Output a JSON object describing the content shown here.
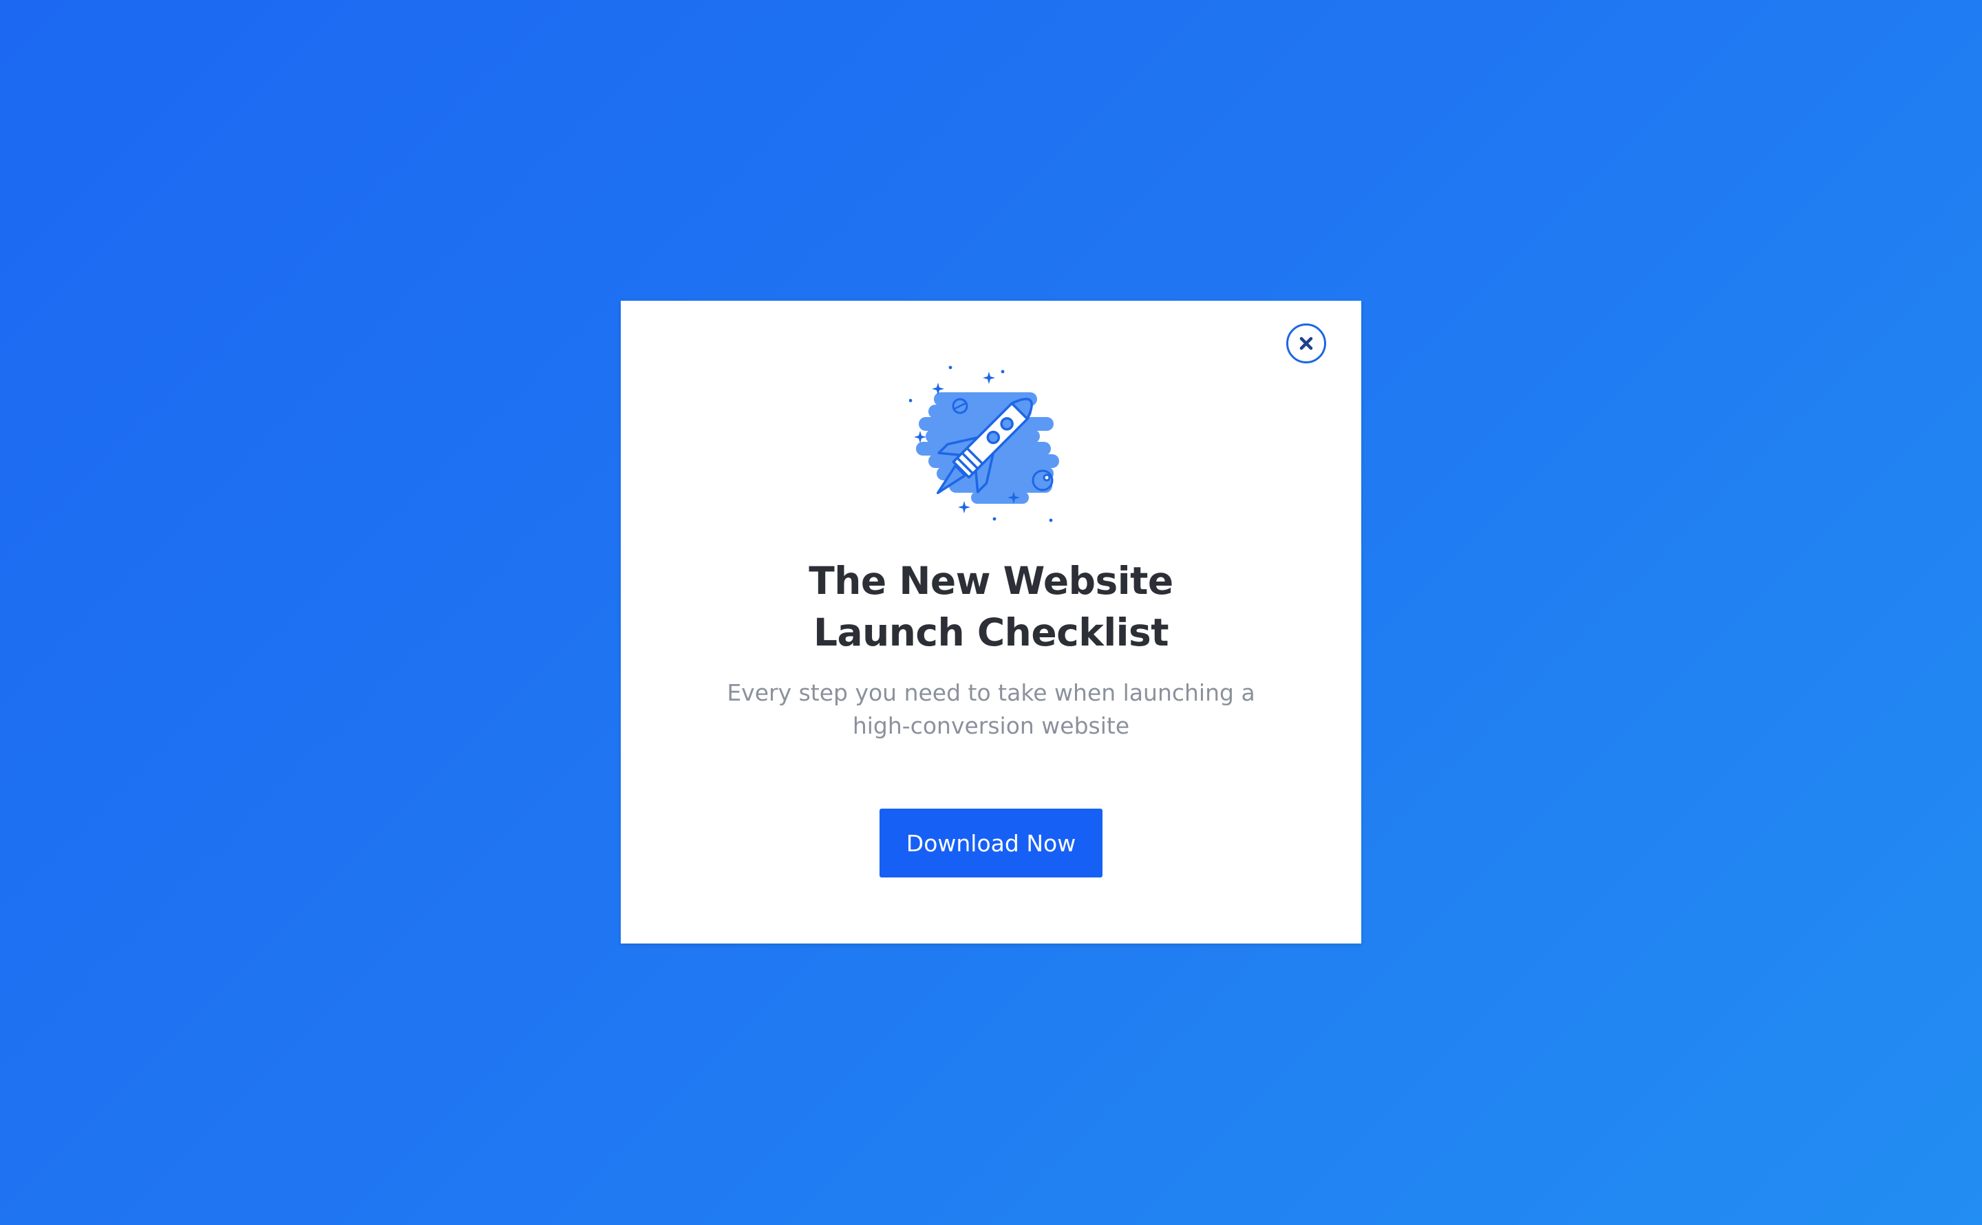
{
  "modal": {
    "title_line1": "The New Website",
    "title_line2": "Launch Checklist",
    "subtitle_line1": "Every step you need to take when launching a",
    "subtitle_line2": "high-conversion website",
    "cta_label": "Download Now",
    "close_icon": "close-icon",
    "illustration_icon": "rocket-icon"
  },
  "colors": {
    "background_start": "#1c68f2",
    "background_end": "#228df2",
    "accent": "#1660f5",
    "title": "#2c2f36",
    "subtitle": "#8b919c",
    "illustration_fill": "#5c99f4"
  }
}
